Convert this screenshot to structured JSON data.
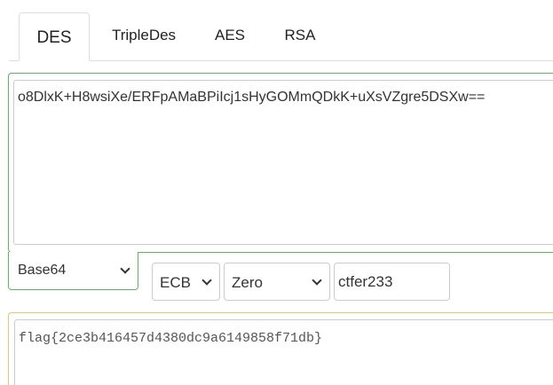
{
  "tabs": {
    "des": "DES",
    "tripledes": "TripleDes",
    "aes": "AES",
    "rsa": "RSA",
    "active": "DES"
  },
  "input": {
    "value": "o8DlxK+H8wsiXe/ERFpAMaBPiIcj1sHyGOMmQDkK+uXsVZgre5DSXw=="
  },
  "controls": {
    "encoding": "Base64",
    "mode": "ECB",
    "padding": "Zero",
    "key": "ctfer233"
  },
  "output": {
    "value": "flag{2ce3b416457d4380dc9a6149858f71db}"
  },
  "colors": {
    "input_border": "#5cb85c",
    "output_border": "#f0c36d",
    "field_border": "#cccccc"
  }
}
